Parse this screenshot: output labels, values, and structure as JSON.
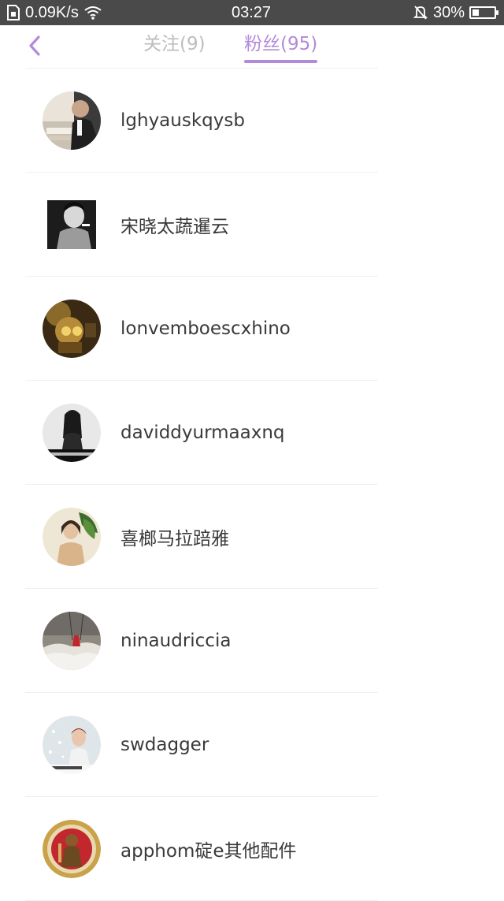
{
  "status_bar": {
    "speed": "0.09K/s",
    "time": "03:27",
    "battery": "30%",
    "battery_level": 0.3
  },
  "header": {
    "tabs": [
      {
        "label": "关注(9)",
        "active": false
      },
      {
        "label": "粉丝(95)",
        "active": true
      }
    ]
  },
  "followers": [
    {
      "name": "lghyauskqysb",
      "avatar": "man-at-desk"
    },
    {
      "name": "宋晓太蔬暹云",
      "avatar": "bw-smoker"
    },
    {
      "name": "lonvemboescxhino",
      "avatar": "game-robot"
    },
    {
      "name": "daviddyurmaaxnq",
      "avatar": "bw-girl-caption"
    },
    {
      "name": "喜榔马拉踣雅",
      "avatar": "girl-with-plant"
    },
    {
      "name": "ninaudriccia",
      "avatar": "swing-in-clouds"
    },
    {
      "name": "swdagger",
      "avatar": "girl-snow"
    },
    {
      "name": "apphom碇e其他配件",
      "avatar": "warrior-badge"
    }
  ],
  "colors": {
    "accent": "#b38ad9",
    "inactive_tab": "#bdbdbd",
    "status_bar": "#4a4a4a"
  }
}
